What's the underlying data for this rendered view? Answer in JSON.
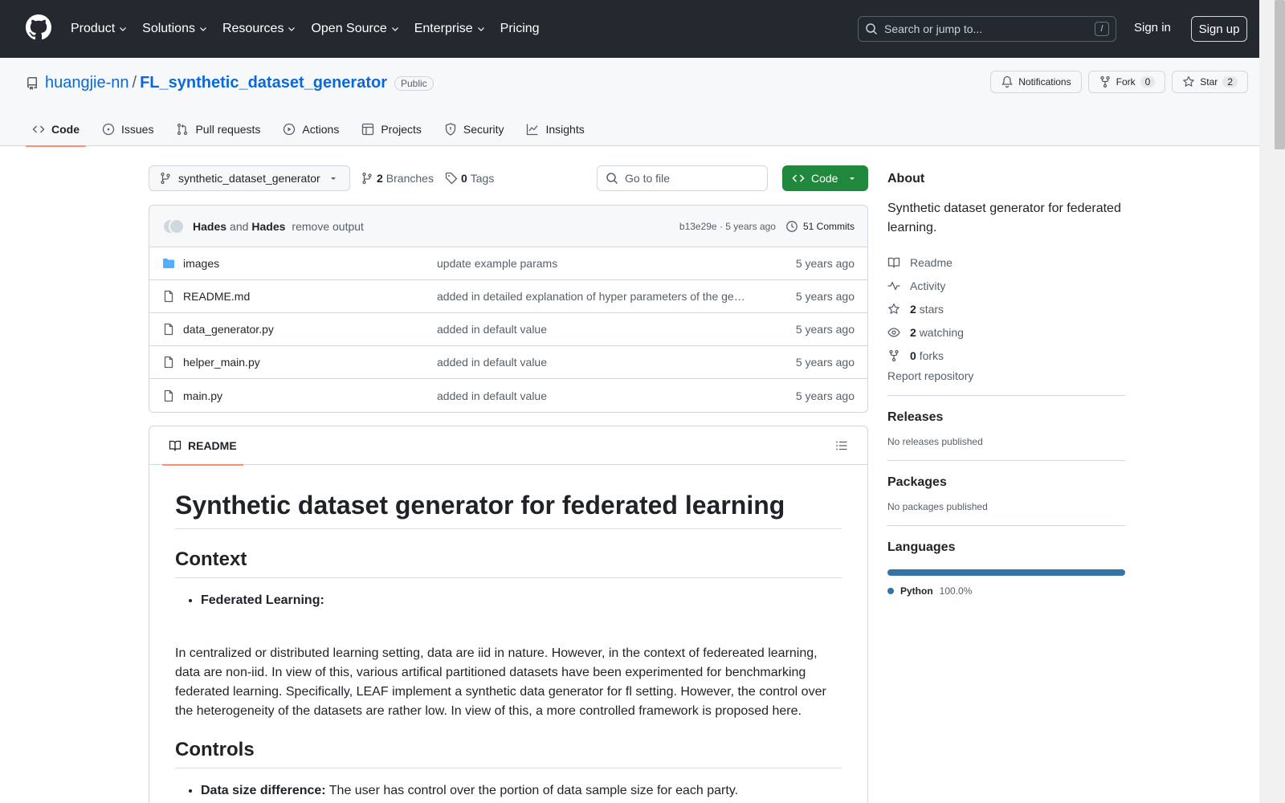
{
  "header": {
    "nav": [
      {
        "label": "Product",
        "dropdown": true
      },
      {
        "label": "Solutions",
        "dropdown": true
      },
      {
        "label": "Resources",
        "dropdown": true
      },
      {
        "label": "Open Source",
        "dropdown": true
      },
      {
        "label": "Enterprise",
        "dropdown": true
      },
      {
        "label": "Pricing",
        "dropdown": false
      }
    ],
    "search_placeholder": "Search or jump to...",
    "search_kbd": "/",
    "signin": "Sign in",
    "signup": "Sign up"
  },
  "repo": {
    "owner": "huangjie-nn",
    "sep": "/",
    "name": "FL_synthetic_dataset_generator",
    "visibility": "Public",
    "notifications": "Notifications",
    "fork_label": "Fork",
    "fork_count": "0",
    "star_label": "Star",
    "star_count": "2"
  },
  "tabs": [
    {
      "label": "Code",
      "active": true
    },
    {
      "label": "Issues"
    },
    {
      "label": "Pull requests"
    },
    {
      "label": "Actions"
    },
    {
      "label": "Projects"
    },
    {
      "label": "Security"
    },
    {
      "label": "Insights"
    }
  ],
  "toolbar": {
    "branch": "synthetic_dataset_generator",
    "branches_count": "2",
    "branches_label": "Branches",
    "tags_count": "0",
    "tags_label": "Tags",
    "goto_placeholder": "Go to file",
    "code_label": "Code"
  },
  "commit": {
    "author1": "Hades",
    "and": "and",
    "author2": "Hades",
    "message": "remove output",
    "sha_time": "b13e29e · 5 years ago",
    "commits": "51 Commits"
  },
  "files": [
    {
      "type": "dir",
      "name": "images",
      "message": "update example params",
      "date": "5 years ago"
    },
    {
      "type": "file",
      "name": "README.md",
      "message": "added in detailed explanation of hyper parameters of the ge…",
      "date": "5 years ago"
    },
    {
      "type": "file",
      "name": "data_generator.py",
      "message": "added in default value",
      "date": "5 years ago"
    },
    {
      "type": "file",
      "name": "helper_main.py",
      "message": "added in default value",
      "date": "5 years ago"
    },
    {
      "type": "file",
      "name": "main.py",
      "message": "added in default value",
      "date": "5 years ago"
    }
  ],
  "readme": {
    "tab": "README",
    "h1": "Synthetic dataset generator for federated learning",
    "h2_context": "Context",
    "li_fl": "Federated Learning:",
    "para": "In centralized or distributed learning setting, data are iid in nature. However, in the context of federeated learning, data are non-iid. In view of this, various artifical partitioned datasets have been experimented for benchmarking federated learning. Specifically, LEAF implement a synthetic data generator for fl setting. However, the control over the heterogeneity of the datasets are rather low. In view of this, a more controlled framework is proposed here.",
    "h2_controls": "Controls",
    "li_ds_bold": "Data size difference:",
    "li_ds_rest": " The user has control over the portion of data sample size for each party."
  },
  "sidebar": {
    "about_title": "About",
    "description": "Synthetic dataset generator for federated learning.",
    "readme": "Readme",
    "activity": "Activity",
    "stars_count": "2",
    "stars_label": "stars",
    "watching_count": "2",
    "watching_label": "watching",
    "forks_count": "0",
    "forks_label": "forks",
    "report": "Report repository",
    "releases_title": "Releases",
    "releases_empty": "No releases published",
    "packages_title": "Packages",
    "packages_empty": "No packages published",
    "languages_title": "Languages",
    "language": {
      "name": "Python",
      "percent": "100.0%",
      "color": "#3572A5",
      "fraction": 1.0
    }
  },
  "colors": {
    "header_bg": "#24292f",
    "primary_button": "#1f883d",
    "link": "#0969da",
    "active_tab_underline": "#fd8c73"
  }
}
